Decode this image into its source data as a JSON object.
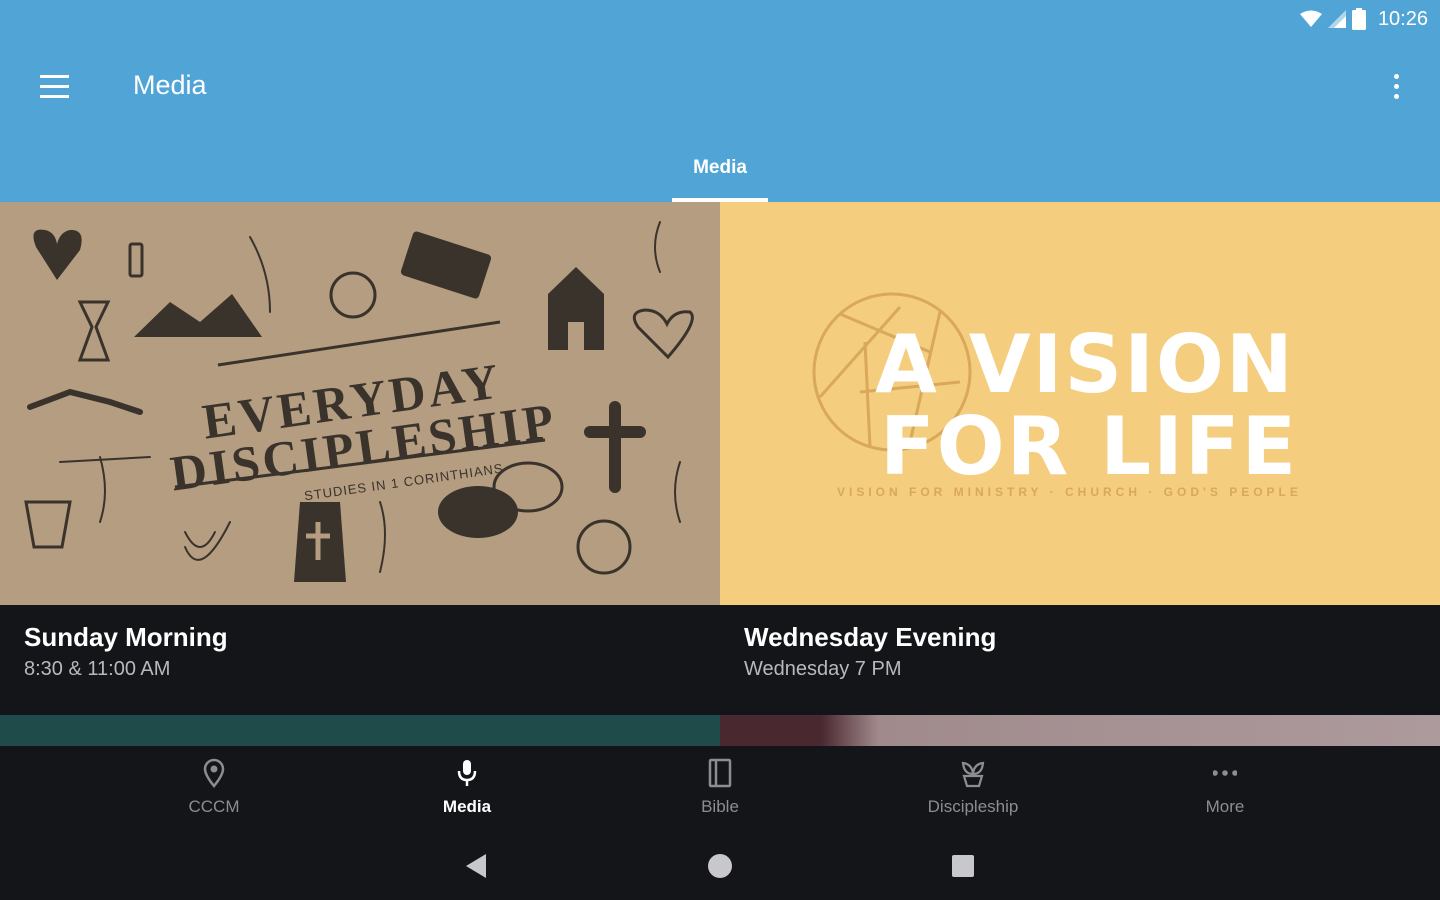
{
  "status_bar": {
    "time": "10:26"
  },
  "app_bar": {
    "title": "Media",
    "menu_icon": "menu-icon",
    "overflow_icon": "more-vert-icon"
  },
  "tabs": [
    {
      "label": "Media",
      "active": true
    }
  ],
  "cards": [
    {
      "title": "Sunday Morning",
      "subtitle": "8:30 & 11:00 AM",
      "art": {
        "line1": "EVERYDAY",
        "line2": "DISCIPLESHIP",
        "tagline": "STUDIES IN 1 CORINTHIANS"
      }
    },
    {
      "title": "Wednesday Evening",
      "subtitle": "Wednesday 7 PM",
      "art": {
        "line1": "A VISION",
        "line2": "FOR LIFE",
        "tagline": "VISION FOR MINISTRY · CHURCH · GOD'S PEOPLE"
      }
    }
  ],
  "bottom_nav": [
    {
      "label": "CCCM",
      "icon": "location-pin-icon",
      "active": false
    },
    {
      "label": "Media",
      "icon": "microphone-icon",
      "active": true
    },
    {
      "label": "Bible",
      "icon": "book-icon",
      "active": false
    },
    {
      "label": "Discipleship",
      "icon": "sprout-icon",
      "active": false
    },
    {
      "label": "More",
      "icon": "more-horiz-icon",
      "active": false
    }
  ],
  "colors": {
    "app_bar": "#51a5d6",
    "background": "#141518",
    "card_yellow": "#f4cd7f",
    "card_kraft": "#b49d80"
  }
}
